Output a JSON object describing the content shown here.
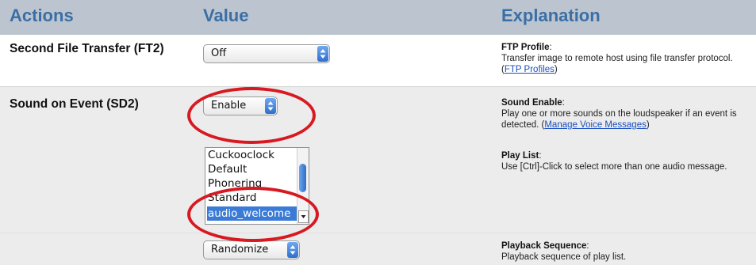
{
  "header": {
    "actions": "Actions",
    "value": "Value",
    "explanation": "Explanation"
  },
  "rows": {
    "ft2": {
      "action": "Second File Transfer (FT2)",
      "select_value": "Off",
      "explain_title": "FTP Profile",
      "explain_sep": ":",
      "explain_text": "Transfer image to remote host using file transfer protocol. (",
      "explain_link": "FTP Profiles",
      "explain_close": ")"
    },
    "sd2": {
      "action": "Sound on Event (SD2)",
      "select_value": "Enable",
      "explain_title": "Sound Enable",
      "explain_sep": ":",
      "explain_text": "Play one or more sounds on the loudspeaker if an event is detected. (",
      "explain_link": "Manage Voice Messages",
      "explain_close": ")",
      "playlist": {
        "items": [
          "Cuckooclock",
          "Default",
          "Phonering",
          "Standard",
          "audio_welcome"
        ],
        "selected": "audio_welcome"
      },
      "playlist_title": "Play List",
      "playlist_sep": ":",
      "playlist_text": "Use [Ctrl]-Click to select more than one audio message."
    },
    "sequence": {
      "select_value": "Randomize",
      "explain_title": "Playback Sequence",
      "explain_sep": ":",
      "explain_text": "Playback sequence of play list."
    }
  },
  "colors": {
    "header_bg": "#bcc5cf",
    "header_text": "#3a6ea5",
    "row_alt_bg": "#ececec",
    "highlight_oval": "#d71921",
    "selection": "#3b7bd6",
    "link": "#1a4fbf"
  },
  "icons": [
    "select-arrows-icon",
    "scroll-down-arrow-icon"
  ]
}
